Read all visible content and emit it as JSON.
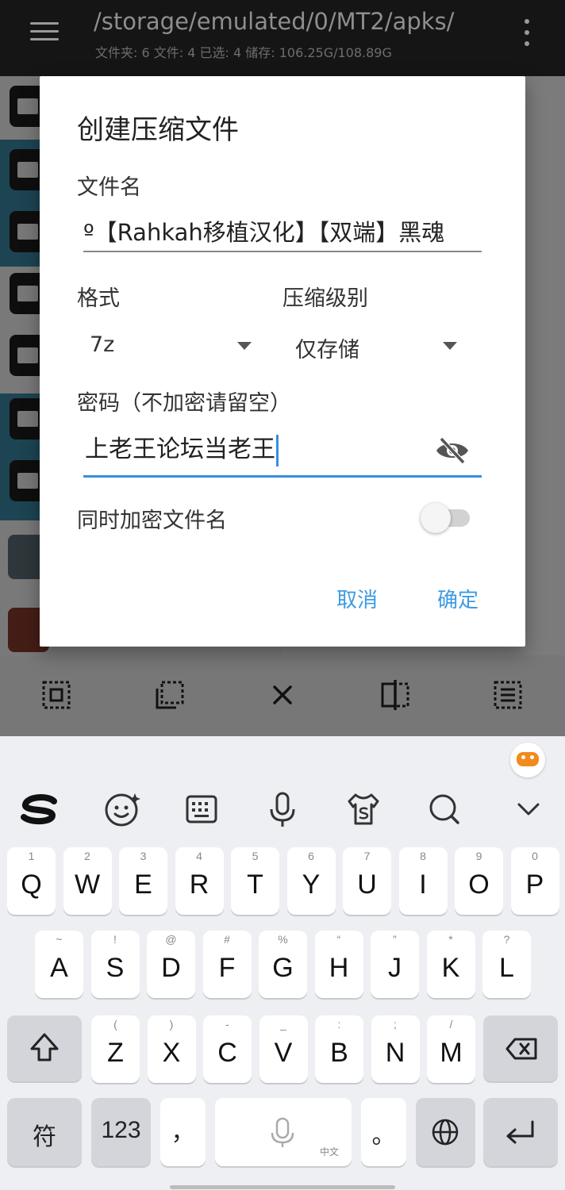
{
  "appbar": {
    "path": "/storage/emulated/0/MT2/apks/",
    "info": "文件夹: 6  文件: 4  已选: 4  储存: 106.25G/108.89G"
  },
  "dialog": {
    "title": "创建压缩文件",
    "filename_label": "文件名",
    "filename_value": "º【Rahkah移植汉化】【双端】黑魂",
    "format_label": "格式",
    "format_value": "7z",
    "level_label": "压缩级别",
    "level_value": "仅存储",
    "password_label": "密码（不加密请留空）",
    "password_value": "上老王论坛当老王",
    "encrypt_names_label": "同时加密文件名",
    "encrypt_names_on": false,
    "cancel": "取消",
    "ok": "确定",
    "accent_color": "#3d9be2"
  },
  "keyboard": {
    "row1": [
      {
        "k": "Q",
        "h": "1"
      },
      {
        "k": "W",
        "h": "2"
      },
      {
        "k": "E",
        "h": "3"
      },
      {
        "k": "R",
        "h": "4"
      },
      {
        "k": "T",
        "h": "5"
      },
      {
        "k": "Y",
        "h": "6"
      },
      {
        "k": "U",
        "h": "7"
      },
      {
        "k": "I",
        "h": "8"
      },
      {
        "k": "O",
        "h": "9"
      },
      {
        "k": "P",
        "h": "0"
      }
    ],
    "row2": [
      {
        "k": "A",
        "h": "~"
      },
      {
        "k": "S",
        "h": "!"
      },
      {
        "k": "D",
        "h": "@"
      },
      {
        "k": "F",
        "h": "#"
      },
      {
        "k": "G",
        "h": "%"
      },
      {
        "k": "H",
        "h": "“"
      },
      {
        "k": "J",
        "h": "”"
      },
      {
        "k": "K",
        "h": "*"
      },
      {
        "k": "L",
        "h": "?"
      }
    ],
    "row3": [
      {
        "k": "Z",
        "h": "("
      },
      {
        "k": "X",
        "h": ")"
      },
      {
        "k": "C",
        "h": "-"
      },
      {
        "k": "V",
        "h": "_"
      },
      {
        "k": "B",
        "h": ":"
      },
      {
        "k": "N",
        "h": ";"
      },
      {
        "k": "M",
        "h": "/"
      }
    ],
    "symbols": "符",
    "numbers": "123",
    "comma": "，",
    "period": "。",
    "space_hint": "中文"
  }
}
